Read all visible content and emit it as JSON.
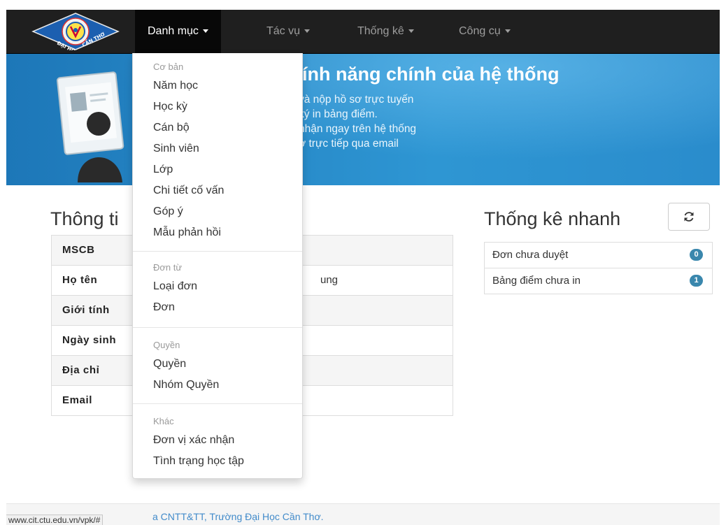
{
  "navbar": {
    "logo_text": "ĐẠI HỌC CẦN THƠ",
    "items": [
      {
        "label": "Danh mục"
      },
      {
        "label": "Tác vụ"
      },
      {
        "label": "Thống kê"
      },
      {
        "label": "Công cụ"
      }
    ]
  },
  "hero": {
    "title": "tính năng chính của hệ thống",
    "lines": [
      "và nộp hồ sơ trực tuyến",
      "ký in bảng điểm.",
      "nhận ngay trên hệ thống",
      "ợ trực tiếp qua email"
    ]
  },
  "info": {
    "title": "Thông ti",
    "rows": [
      {
        "label": "MSCB",
        "value": ""
      },
      {
        "label": "Họ tên",
        "value": "ung"
      },
      {
        "label": "Giới tính",
        "value": ""
      },
      {
        "label": "Ngày sinh",
        "value": ""
      },
      {
        "label": "Địa chỉ",
        "value": ""
      },
      {
        "label": "Email",
        "value": ""
      }
    ]
  },
  "stats": {
    "title": "Thống kê nhanh",
    "refresh_icon": "refresh-icon",
    "items": [
      {
        "label": "Đơn chưa duyệt",
        "count": "0"
      },
      {
        "label": "Bảng điểm chưa in",
        "count": "1"
      }
    ]
  },
  "dropdown": {
    "groups": [
      {
        "header": "Cơ bản",
        "items": [
          "Năm học",
          "Học kỳ",
          "Cán bộ",
          "Sinh viên",
          "Lớp",
          "Chi tiết cố vấn",
          "Góp ý",
          "Mẫu phản hồi"
        ]
      },
      {
        "header": "Đơn từ",
        "items": [
          "Loại đơn",
          "Đơn"
        ]
      },
      {
        "header": "Quyền",
        "items": [
          "Quyền",
          "Nhóm Quyền"
        ]
      },
      {
        "header": "Khác",
        "items": [
          "Đơn vị xác nhận",
          "Tình trạng học tập"
        ]
      }
    ]
  },
  "footer": {
    "text": "a CNTT&TT, Trường Đại Học Cần Thơ."
  },
  "status_url": "www.cit.ctu.edu.vn/vpk/#",
  "colors": {
    "navbar": "#1f1f1f",
    "hero": "#2b8fce",
    "badge": "#3a87ad",
    "link": "#428bca"
  }
}
